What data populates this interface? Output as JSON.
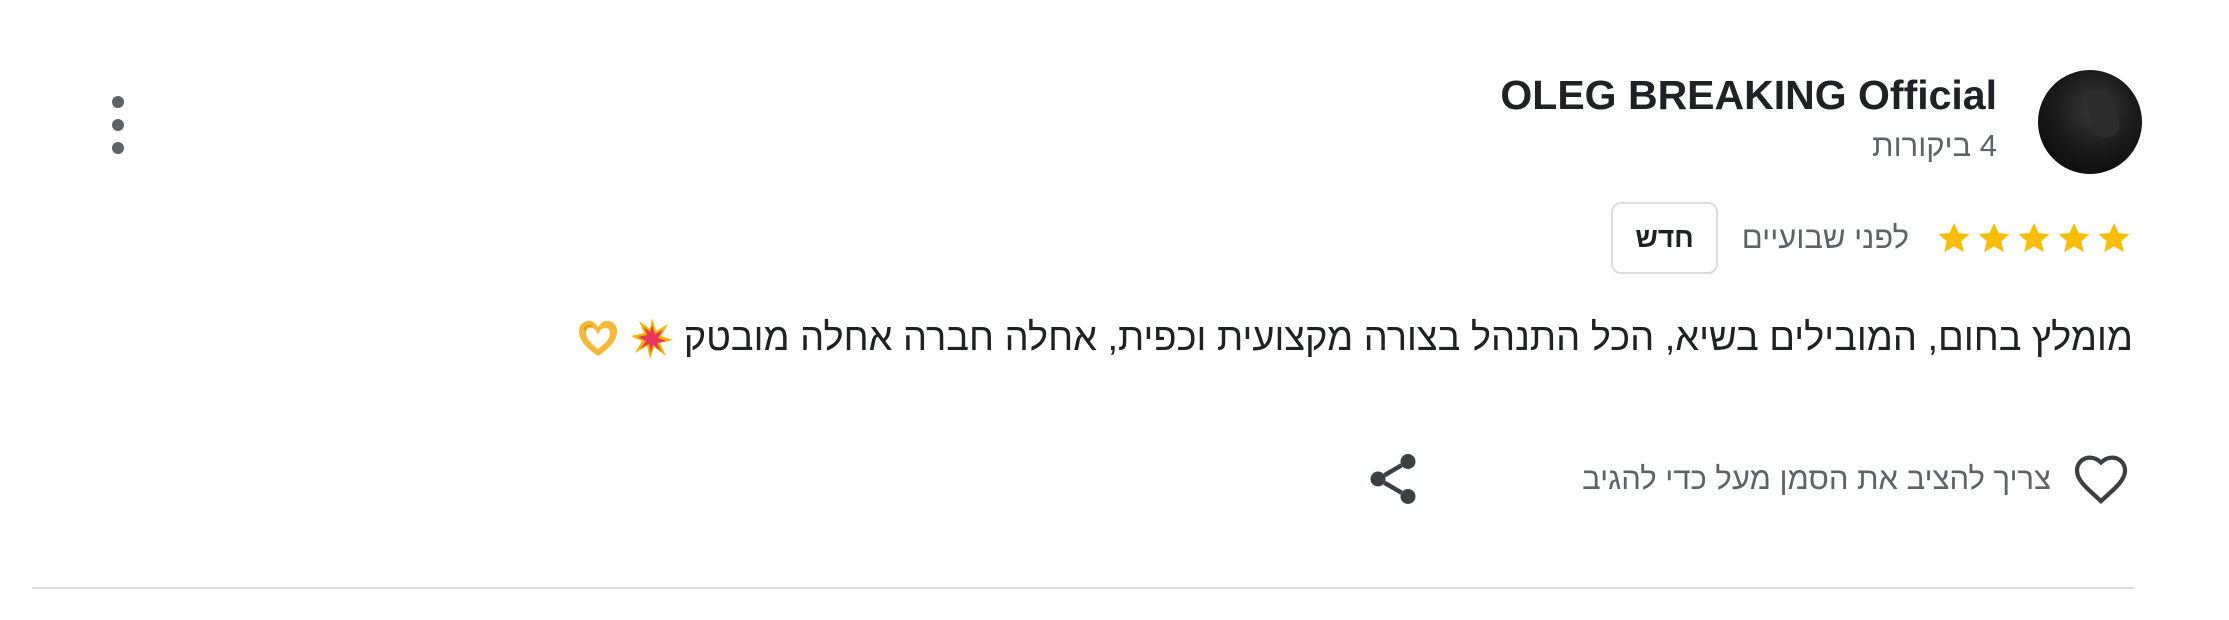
{
  "review": {
    "author_name": "OLEG BREAKING Official",
    "review_count": "4 ביקורות",
    "rating": 5,
    "rating_max": 5,
    "time": "לפני שבועיים",
    "badge": "חדש",
    "text": "מומלץ בחום, המובילים בשיא, הכל התנהל בצורה מקצועית וכפית, אחלה חברה אחלה מובטק",
    "emojis": [
      "collision-emoji",
      "heart-hands-emoji"
    ],
    "like_hint": "צריך להציב את הסמן מעל כדי להגיב"
  },
  "icons": {
    "more": "more-vert-icon",
    "star": "star-icon",
    "heart": "heart-outline-icon",
    "share": "share-icon"
  },
  "colors": {
    "star": "#fbbc04",
    "text_primary": "#202124",
    "text_secondary": "#5f6368",
    "icon": "#3c4043",
    "divider": "#dadce0"
  }
}
